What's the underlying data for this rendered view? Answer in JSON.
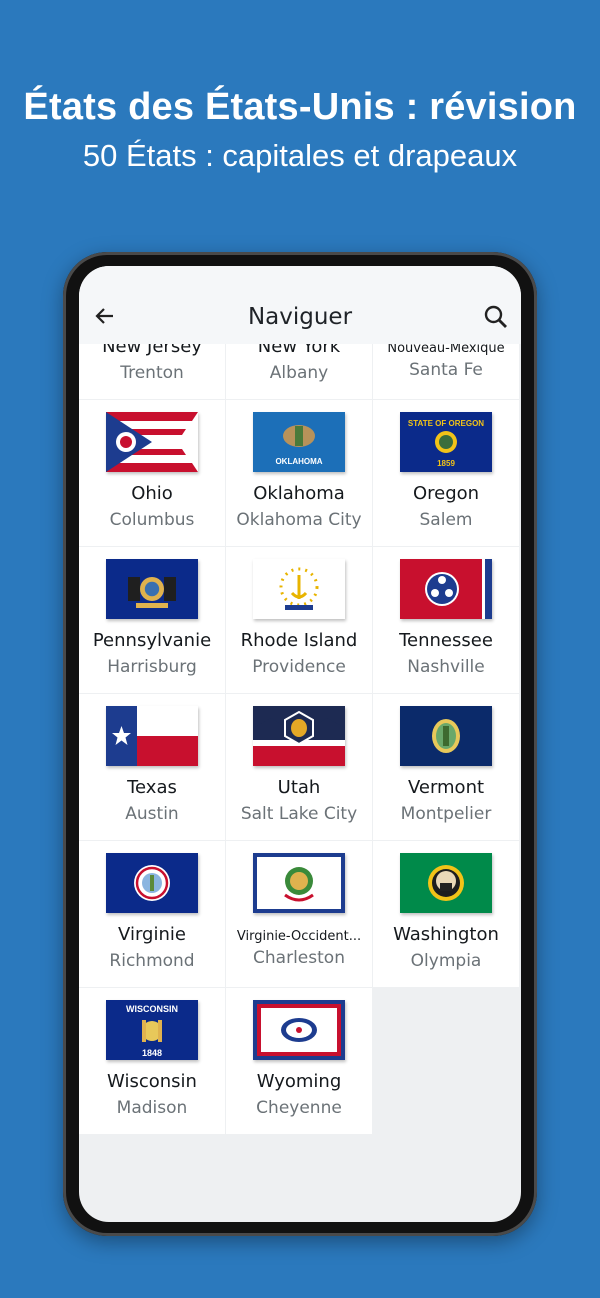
{
  "promo": {
    "title": "États des États-Unis : révision",
    "subtitle": "50 États : capitales et drapeaux"
  },
  "appbar": {
    "title": "Naviguer",
    "back_icon": "arrow-left-icon",
    "search_icon": "search-icon"
  },
  "states": [
    {
      "name": "New Jersey",
      "capital": "Trenton",
      "flag": "nj"
    },
    {
      "name": "New York",
      "capital": "Albany",
      "flag": "ny"
    },
    {
      "name": "Nouveau-Mexique",
      "capital": "Santa Fe",
      "flag": "nm"
    },
    {
      "name": "Ohio",
      "capital": "Columbus",
      "flag": "oh"
    },
    {
      "name": "Oklahoma",
      "capital": "Oklahoma City",
      "flag": "ok",
      "flag_text": "OKLAHOMA"
    },
    {
      "name": "Oregon",
      "capital": "Salem",
      "flag": "or",
      "flag_text": "STATE OF OREGON",
      "flag_year": "1859"
    },
    {
      "name": "Pennsylvanie",
      "capital": "Harrisburg",
      "flag": "pa"
    },
    {
      "name": "Rhode Island",
      "capital": "Providence",
      "flag": "ri"
    },
    {
      "name": "Tennessee",
      "capital": "Nashville",
      "flag": "tn"
    },
    {
      "name": "Texas",
      "capital": "Austin",
      "flag": "tx"
    },
    {
      "name": "Utah",
      "capital": "Salt Lake City",
      "flag": "ut"
    },
    {
      "name": "Vermont",
      "capital": "Montpelier",
      "flag": "vt"
    },
    {
      "name": "Virginie",
      "capital": "Richmond",
      "flag": "va"
    },
    {
      "name": "Virginie-Occident...",
      "capital": "Charleston",
      "flag": "wv"
    },
    {
      "name": "Washington",
      "capital": "Olympia",
      "flag": "wa"
    },
    {
      "name": "Wisconsin",
      "capital": "Madison",
      "flag": "wi",
      "flag_text": "WISCONSIN",
      "flag_year": "1848"
    },
    {
      "name": "Wyoming",
      "capital": "Cheyenne",
      "flag": "wy"
    }
  ],
  "colors": {
    "background": "#2b79bd",
    "navy": "#1d3c8f",
    "red": "#c8102e",
    "gold": "#f2c318"
  }
}
